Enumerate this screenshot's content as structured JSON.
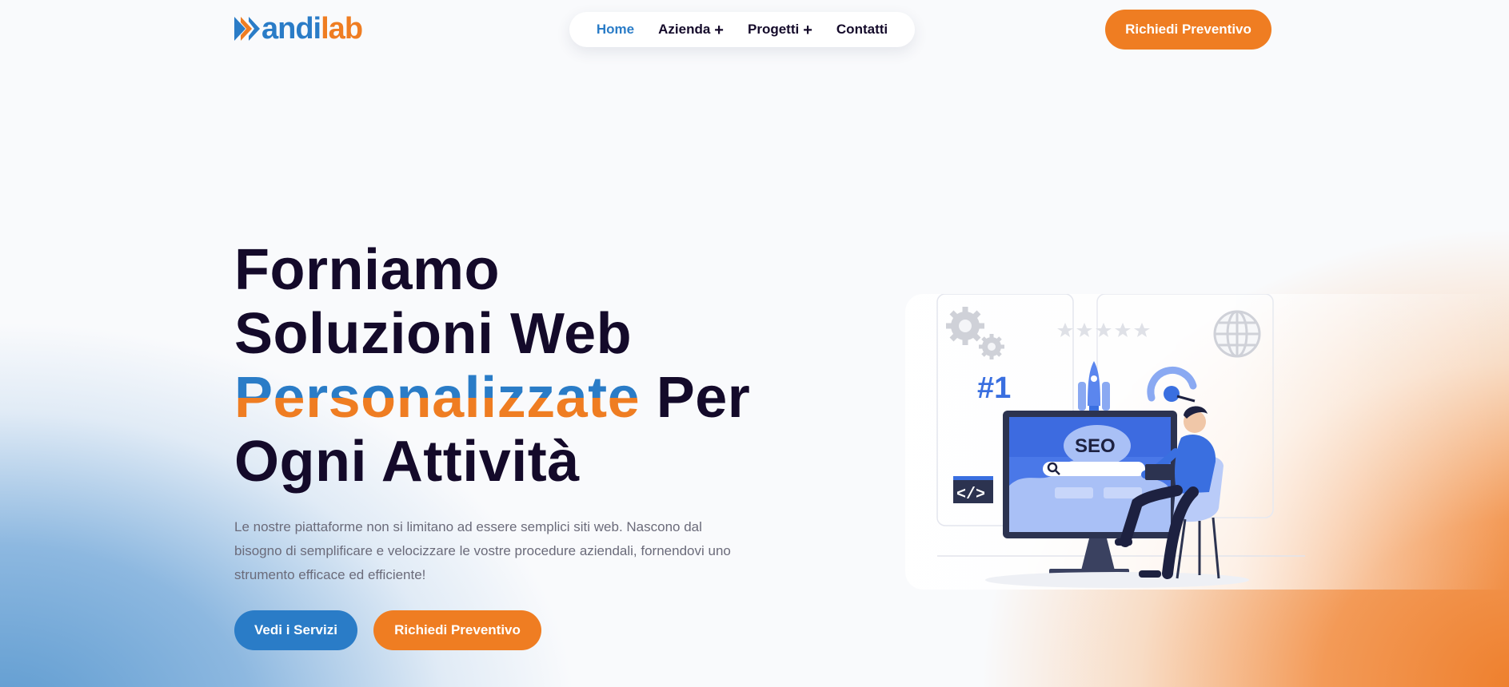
{
  "brand": {
    "logo_part1": "andi",
    "logo_part2": "lab",
    "blue": "#2a7cc7",
    "orange": "#ef7d22",
    "dark": "#140a2a"
  },
  "nav": {
    "items": [
      {
        "label": "Home",
        "active": true
      },
      {
        "label": "Azienda",
        "submenu": true
      },
      {
        "label": "Progetti",
        "submenu": true
      },
      {
        "label": "Contatti"
      }
    ],
    "plus_icon": "+"
  },
  "header": {
    "cta_label": "Richiedi Preventivo"
  },
  "hero": {
    "title_line1": "Forniamo",
    "title_line2": "Soluzioni Web",
    "title_highlight": "Personalizzate",
    "title_line3_rest": " Per",
    "title_line4": "Ogni Attività",
    "description": "Le nostre piattaforme non si limitano ad essere semplici siti web. Nascono dal bisogno di semplificare e velocizzare le vostre procedure aziendali, fornendovi uno strumento efficace ed efficiente!",
    "btn_services": "Vedi i Servizi",
    "btn_quote": "Richiedi Preventivo"
  },
  "illustration": {
    "rank_text": "#1",
    "seo_text": "SEO",
    "code_text": "</>",
    "icons": [
      "gears-icon",
      "globe-icon",
      "rocket-icon",
      "wifi-icon",
      "stars-icon",
      "search-icon"
    ]
  }
}
